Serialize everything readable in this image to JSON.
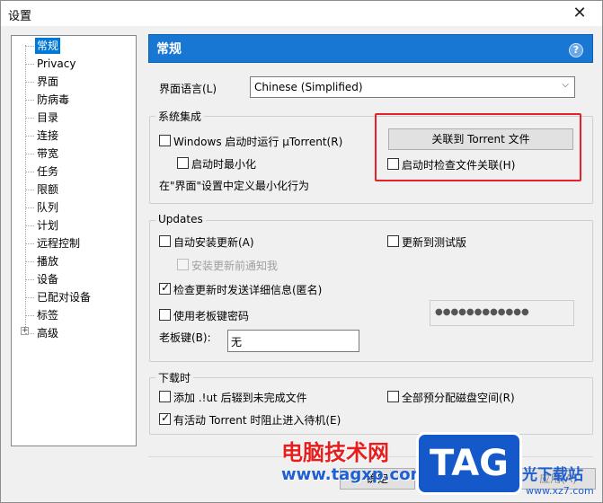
{
  "window": {
    "title": "设置",
    "close_glyph": "✕"
  },
  "tree": {
    "items": [
      "常规",
      "Privacy",
      "界面",
      "防病毒",
      "目录",
      "连接",
      "带宽",
      "任务",
      "限额",
      "队列",
      "计划",
      "远程控制",
      "播放",
      "设备",
      "已配对设备",
      "标签",
      "高级"
    ],
    "selected": "常规",
    "expander_glyph": "+"
  },
  "header": {
    "title": "常规",
    "help_glyph": "?"
  },
  "language": {
    "label": "界面语言(L)",
    "value": "Chinese (Simplified)",
    "chevron": "⌵"
  },
  "system": {
    "title": "系统集成",
    "startup_label": "Windows 启动时运行 µTorrent(R)",
    "startup_checked": false,
    "minimized_label": "启动时最小化",
    "minimized_checked": false,
    "note": "在\"界面\"设置中定义最小化行为",
    "associate_button": "关联到 Torrent 文件",
    "check_assoc_label": "启动时检查文件关联(H)",
    "check_assoc_checked": false
  },
  "updates": {
    "title": "Updates",
    "auto_install_label": "自动安装更新(A)",
    "auto_install_checked": false,
    "beta_label": "更新到测试版",
    "beta_checked": false,
    "notify_label": "安装更新前通知我",
    "notify_checked": false,
    "anon_label": "检查更新时发送详细信息(匿名)",
    "anon_checked": true,
    "boss_pw_label": "使用老板键密码",
    "boss_pw_checked": false,
    "boss_pw_value": "●●●●●●●●●●●●",
    "boss_key_label": "老板键(B):",
    "boss_key_value": "无"
  },
  "download": {
    "title": "下载时",
    "lut_label": "添加 .!ut 后辍到未完成文件",
    "lut_checked": false,
    "prealloc_label": "全部预分配磁盘空间(R)",
    "prealloc_checked": false,
    "standby_label": "有活动 Torrent 时阻止进入待机(E)",
    "standby_checked": true
  },
  "buttons": {
    "ok": "确定",
    "apply": "应用(A)"
  },
  "watermark": {
    "text": "电脑技术网",
    "url": "www.tagxp.com",
    "logo": "TAG",
    "side": "光下载站",
    "site": "www.xz7.com"
  }
}
